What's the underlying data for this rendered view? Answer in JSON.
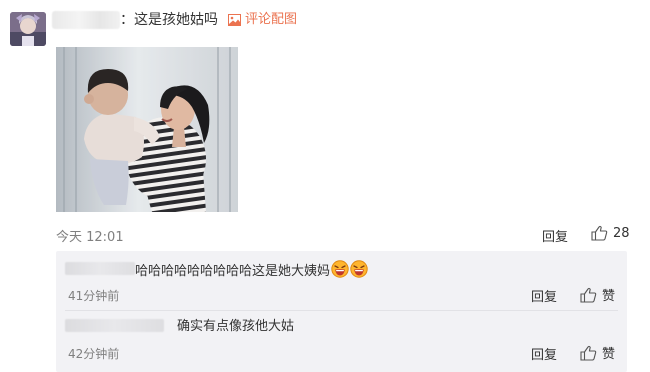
{
  "comment": {
    "text": "：这是孩她姑吗",
    "image_link_label": "评论配图",
    "time": "今天 12:01",
    "reply_label": "回复",
    "like_count": "28"
  },
  "replies": [
    {
      "text": "哈哈哈哈哈哈哈哈哈这是她大姨妈",
      "emoji_count": 2,
      "time": "41分钟前",
      "reply_label": "回复",
      "like_label": "赞"
    },
    {
      "text": "确实有点像孩他大姑",
      "time": "42分钟前",
      "reply_label": "回复",
      "like_label": "赞"
    }
  ],
  "colors": {
    "link": "#eb7350",
    "secondary_text": "#808080",
    "reply_bg": "#f2f2f5"
  }
}
